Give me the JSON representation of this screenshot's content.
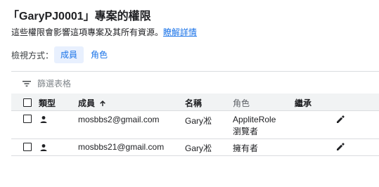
{
  "header": {
    "title": "「GaryPJ0001」專案的權限",
    "description": "這些權限會影響這項專案及其所有資源。",
    "learn_more": "瞭解詳情"
  },
  "view_mode": {
    "label": "檢視方式：",
    "options": [
      {
        "label": "成員",
        "selected": true
      },
      {
        "label": "角色",
        "selected": false
      }
    ]
  },
  "filter": {
    "placeholder": "篩選表格",
    "icon": "filter-icon"
  },
  "table": {
    "columns": {
      "type": "類型",
      "member": "成員",
      "member_sort": "arrow-up-icon",
      "name": "名稱",
      "role": "角色",
      "inherit": "繼承"
    },
    "rows": [
      {
        "type_icon": "person-icon",
        "member": "mosbbs2@gmail.com",
        "name": "Gary凇",
        "roles": [
          "AppliteRole",
          "瀏覽者"
        ],
        "inherit": ""
      },
      {
        "type_icon": "person-icon",
        "member": "mosbbs21@gmail.com",
        "name": "Gary凇",
        "roles": [
          "擁有者"
        ],
        "inherit": ""
      }
    ]
  },
  "colors": {
    "accent": "#1a73e8",
    "chip_bg": "#e8f0fe",
    "header_bg": "#f1f3f4",
    "divider": "#dadce0"
  }
}
